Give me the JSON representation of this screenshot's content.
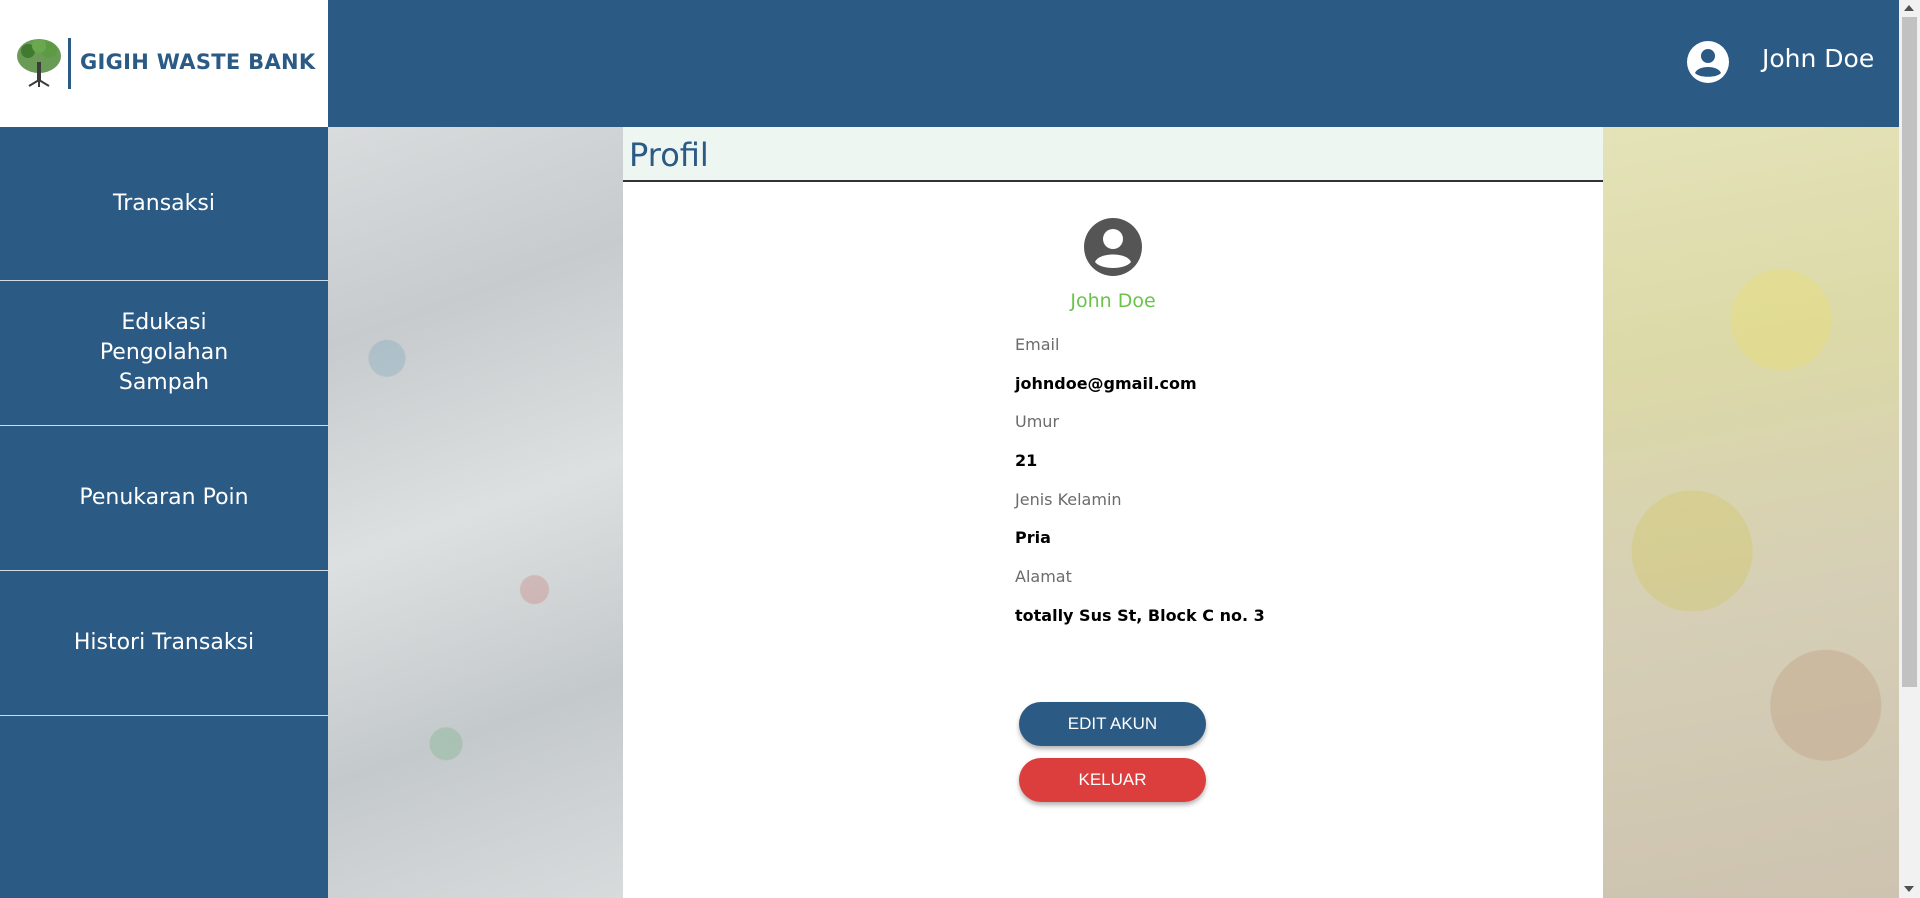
{
  "brand": {
    "name": "GIGIH WASTE BANK",
    "logo_icon": "tree-logo-icon",
    "color": "#2b5a84"
  },
  "header": {
    "user_name": "John Doe",
    "user_icon": "account-circle-icon"
  },
  "sidebar": {
    "items": [
      {
        "label": "Transaksi"
      },
      {
        "label": "Edukasi Pengolahan Sampah"
      },
      {
        "label": "Penukaran Poin"
      },
      {
        "label": "Histori Transaksi"
      }
    ]
  },
  "page": {
    "title": "Profil"
  },
  "profile": {
    "avatar_icon": "account-circle-icon",
    "name": "John Doe",
    "fields": [
      {
        "label": "Email",
        "value": "johndoe@gmail.com"
      },
      {
        "label": "Umur",
        "value": "21"
      },
      {
        "label": "Jenis Kelamin",
        "value": "Pria"
      },
      {
        "label": "Alamat",
        "value": "totally Sus St, Block C no. 3"
      }
    ]
  },
  "actions": {
    "edit_label": "EDIT AKUN",
    "logout_label": "KELUAR"
  },
  "colors": {
    "accent": "#2b5a84",
    "name_green": "#6ac44a",
    "danger": "#dc3e3e",
    "title_bg": "#eef6f2"
  }
}
